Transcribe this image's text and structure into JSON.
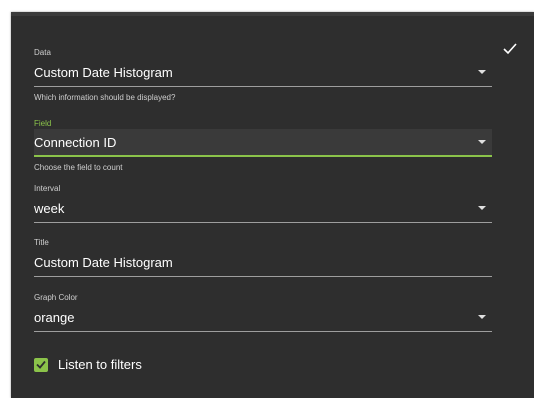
{
  "form": {
    "data": {
      "label": "Data",
      "value": "Custom Date Histogram",
      "hint": "Which information should be displayed?"
    },
    "field": {
      "label": "Field",
      "value": "Connection ID",
      "hint": "Choose the field to count"
    },
    "interval": {
      "label": "Interval",
      "value": "week"
    },
    "title": {
      "label": "Title",
      "value": "Custom Date Histogram"
    },
    "graph_color": {
      "label": "Graph Color",
      "value": "orange"
    },
    "listen_filters": {
      "label": "Listen to filters",
      "checked": true
    }
  },
  "icons": {
    "confirm": "check-icon",
    "dropdown": "chevron-down-icon",
    "checkbox": "checkbox-checked-icon"
  },
  "colors": {
    "panel_bg": "#2e2e2e",
    "accent": "#8bc34a",
    "text": "#ffffff",
    "muted": "#cfcfcf",
    "underline": "#9e9e9e"
  }
}
